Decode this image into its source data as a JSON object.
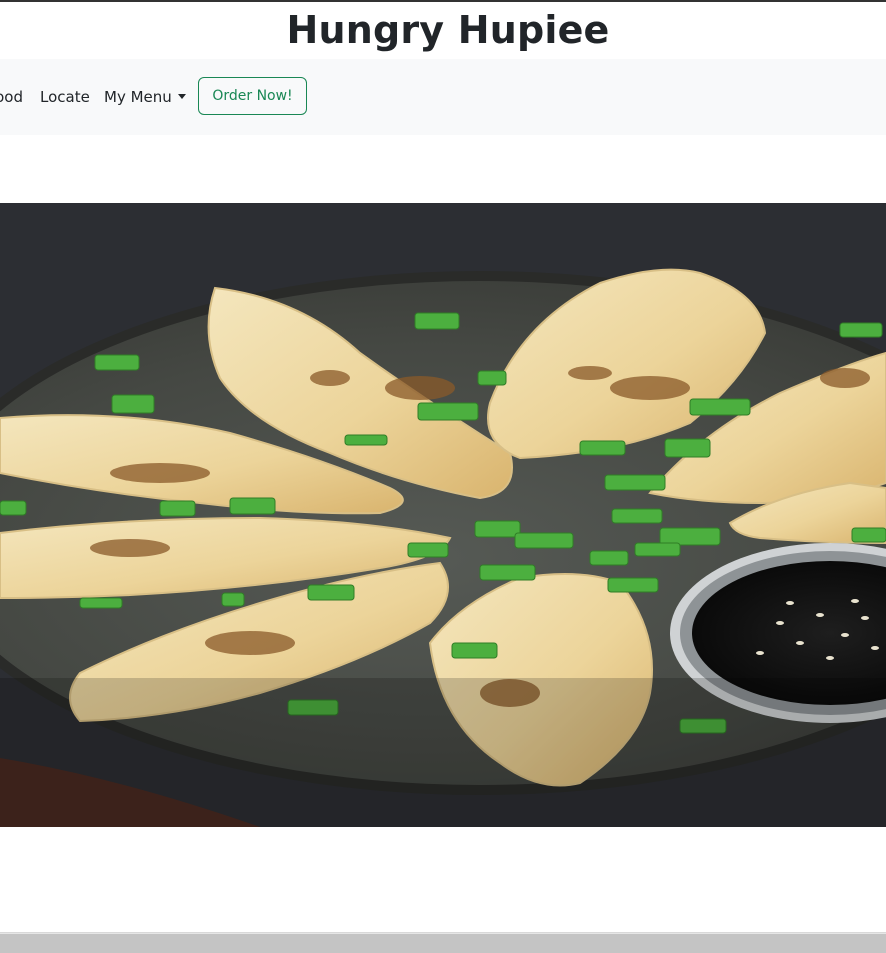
{
  "site": {
    "title": "Hungry Hupiee"
  },
  "nav": {
    "items": [
      {
        "label": "Food"
      },
      {
        "label": "Locate"
      },
      {
        "label": "My Menu"
      }
    ],
    "order_button": "Order Now!"
  },
  "hero": {
    "image": "dumplings-plate-photo"
  },
  "colors": {
    "navbar_bg": "#f8f9fa",
    "accent_green": "#198754",
    "text": "#212529"
  }
}
